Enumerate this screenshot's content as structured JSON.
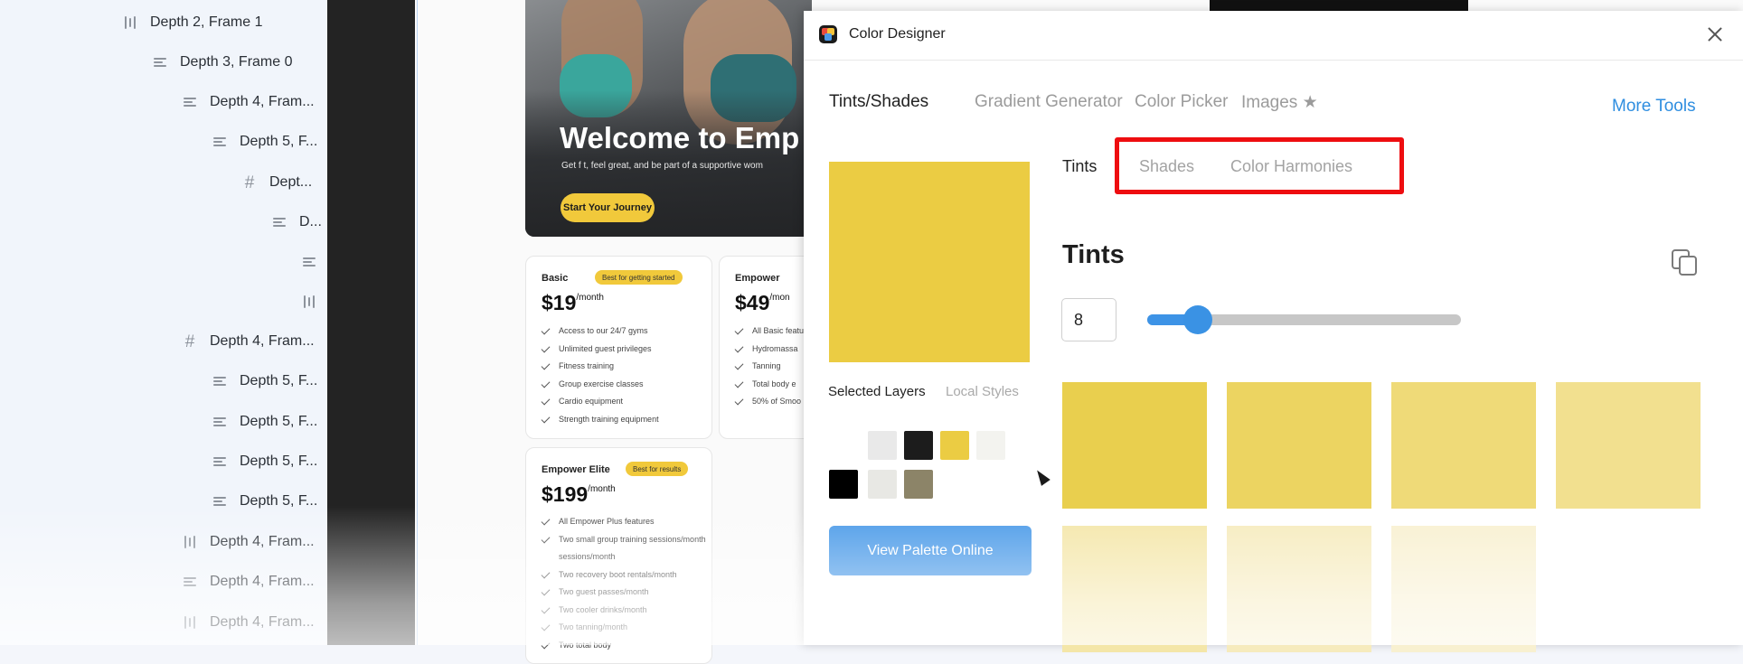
{
  "layers": [
    {
      "label": "Depth 2, Frame 1",
      "icon": "bars-icon",
      "indent": 0
    },
    {
      "label": "Depth 3, Frame 0",
      "icon": "lines-icon",
      "indent": 1
    },
    {
      "label": "Depth 4, Fram...",
      "icon": "lines-icon",
      "indent": 2
    },
    {
      "label": "Depth 5, F...",
      "icon": "lines-icon",
      "indent": 3
    },
    {
      "label": "Dept...",
      "icon": "hash-icon",
      "indent": 4
    },
    {
      "label": "D...",
      "icon": "lines-icon",
      "indent": 5
    },
    {
      "label": "",
      "icon": "lines-icon",
      "indent": 6
    },
    {
      "label": "",
      "icon": "bars-icon",
      "indent": 6
    },
    {
      "label": "Depth 4, Fram...",
      "icon": "hash-icon",
      "indent": 2
    },
    {
      "label": "Depth 5, F...",
      "icon": "lines-icon",
      "indent": 3
    },
    {
      "label": "Depth 5, F...",
      "icon": "lines-icon",
      "indent": 3
    },
    {
      "label": "Depth 5, F...",
      "icon": "lines-icon",
      "indent": 3
    },
    {
      "label": "Depth 5, F...",
      "icon": "lines-icon",
      "indent": 3
    },
    {
      "label": "Depth 4, Fram...",
      "icon": "bars-icon",
      "indent": 2
    },
    {
      "label": "Depth 4, Fram...",
      "icon": "lines-icon",
      "indent": 2
    },
    {
      "label": "Depth 4, Fram...",
      "icon": "bars-icon",
      "indent": 2
    }
  ],
  "canvas": {
    "hero": {
      "title": "Welcome to Emp",
      "subtitle": "Get f t, feel great, and be part of a supportive wom",
      "cta": "Start Your Journey"
    },
    "cards": {
      "basic": {
        "name": "Basic",
        "badge": "Best for getting started",
        "price": "$19",
        "period": "/month",
        "features": [
          "Access to our 24/7 gyms",
          "Unlimited guest privileges",
          "Fitness training",
          "Group exercise classes",
          "Cardio equipment",
          "Strength training equipment"
        ]
      },
      "empower": {
        "name": "Empower",
        "price": "$49",
        "period": "/mon",
        "features": [
          "All Basic featu",
          "Hydromassa",
          "Tanning",
          "Total body e",
          "50% of Smoo"
        ]
      },
      "elite": {
        "name": "Empower Elite",
        "badge": "Best for results",
        "price": "$199",
        "period": "/month",
        "features": [
          "All Empower Plus features",
          "Two small group training sessions/month",
          "",
          "Two recovery boot rentals/month",
          "Two guest passes/month",
          "Two cooler drinks/month",
          "Two tanning/month",
          "Two total body"
        ]
      }
    }
  },
  "plugin": {
    "title": "Color Designer",
    "tabs": [
      {
        "label": "Tints/Shades",
        "active": true
      },
      {
        "label": "Gradient Generator",
        "active": false
      },
      {
        "label": "Color Picker",
        "active": false
      },
      {
        "label": "Images ★",
        "active": false
      }
    ],
    "more_tools": "More Tools",
    "subtabs": [
      {
        "label": "Tints",
        "active": true
      },
      {
        "label": "Shades",
        "active": false
      },
      {
        "label": "Color Harmonies",
        "active": false
      }
    ],
    "section_title": "Tints",
    "count_value": "8",
    "slider_fraction": 0.16,
    "preview_color": "#ebcc43",
    "layer_tabs": [
      {
        "label": "Selected Layers",
        "active": true
      },
      {
        "label": "Local Styles",
        "active": false
      }
    ],
    "swatches_row1": [
      "#e9e9e9",
      "#1c1c1c",
      "#ebcc43",
      "#f3f3ef"
    ],
    "swatches_row2": [
      "#000000",
      "#e8e8e4",
      "#8c8468"
    ],
    "tints_row1": [
      "#e9cf4e",
      "#ecd461",
      "#efda78",
      "#f2e08f"
    ],
    "tints_row2": [
      "#f4e6a8",
      "#f6ebbd",
      "#f8f0d0"
    ],
    "palette_button": "View Palette Online",
    "accent_color": "#3d93e6",
    "highlight_color": "#ee0d10"
  }
}
